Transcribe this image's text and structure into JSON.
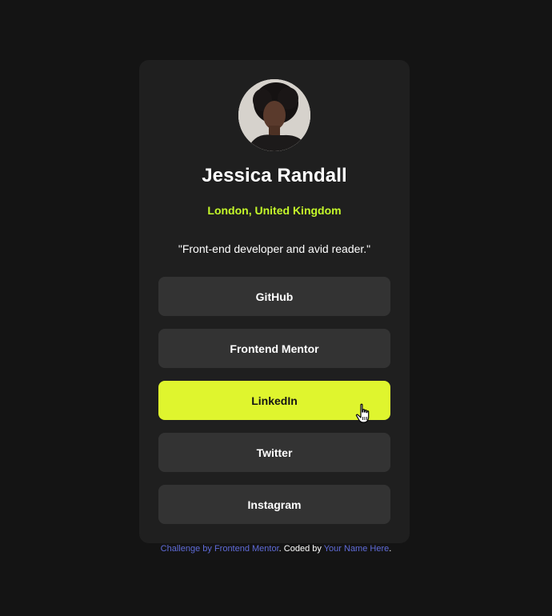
{
  "profile": {
    "name": "Jessica Randall",
    "location": "London, United Kingdom",
    "bio": "\"Front-end developer and avid reader.\""
  },
  "links": [
    {
      "label": "GitHub",
      "active": false
    },
    {
      "label": "Frontend Mentor",
      "active": false
    },
    {
      "label": "LinkedIn",
      "active": true
    },
    {
      "label": "Twitter",
      "active": false
    },
    {
      "label": "Instagram",
      "active": false
    }
  ],
  "attribution": {
    "challenge_link": "Challenge by Frontend Mentor",
    "coded_by": ". Coded by ",
    "author_link": "Your Name Here",
    "end": "."
  },
  "colors": {
    "background": "#141414",
    "card": "#1f1f1f",
    "button": "#333333",
    "accent": "#c4f82a",
    "link": "#5f6bd8"
  },
  "icons": {
    "cursor": "hand-pointer-icon"
  }
}
